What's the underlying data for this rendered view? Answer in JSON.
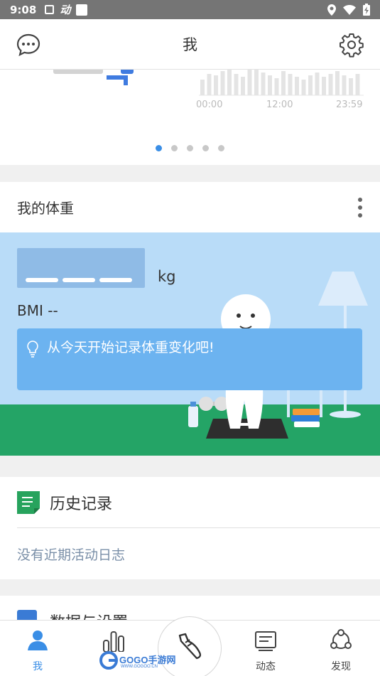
{
  "status_bar": {
    "time": "9:08",
    "icons": [
      "a-notification-icon",
      "dong-app-icon",
      "square-app-icon",
      "location-icon",
      "wifi-icon",
      "battery-charging-icon"
    ],
    "app_glyph": "动"
  },
  "app_bar": {
    "title": "我",
    "left_icon": "chat-icon",
    "right_icon": "settings-gear-icon"
  },
  "carousel": {
    "chart_time_labels": [
      "00:00",
      "12:00",
      "23:59"
    ],
    "page_count": 5,
    "active_page": 1
  },
  "weight_card": {
    "title": "我的体重",
    "unit": "kg",
    "bmi": "BMI --",
    "tip": "从今天开始记录体重变化吧!"
  },
  "history_card": {
    "title": "历史记录",
    "empty_text": "没有近期活动日志"
  },
  "settings_card": {
    "title": "数据与设置"
  },
  "tab_bar": {
    "tabs": [
      {
        "label": "我",
        "icon": "person-icon",
        "active": true
      },
      {
        "label": "",
        "icon": "bar-chart-icon",
        "active": false
      },
      {
        "label": "",
        "icon": "shoe-icon",
        "active": false
      },
      {
        "label": "动态",
        "icon": "news-icon",
        "active": false
      },
      {
        "label": "发现",
        "icon": "discover-icon",
        "active": false
      }
    ]
  },
  "watermark": {
    "brand": "GOGO手游网",
    "domain": "WWW.GOGOO.CN"
  },
  "colors": {
    "accent": "#3a8ee6",
    "banner_sky": "#b9dcf8",
    "ground": "#24a466",
    "tip_bg": "#6cb3f0",
    "history_green": "#27a35d"
  }
}
